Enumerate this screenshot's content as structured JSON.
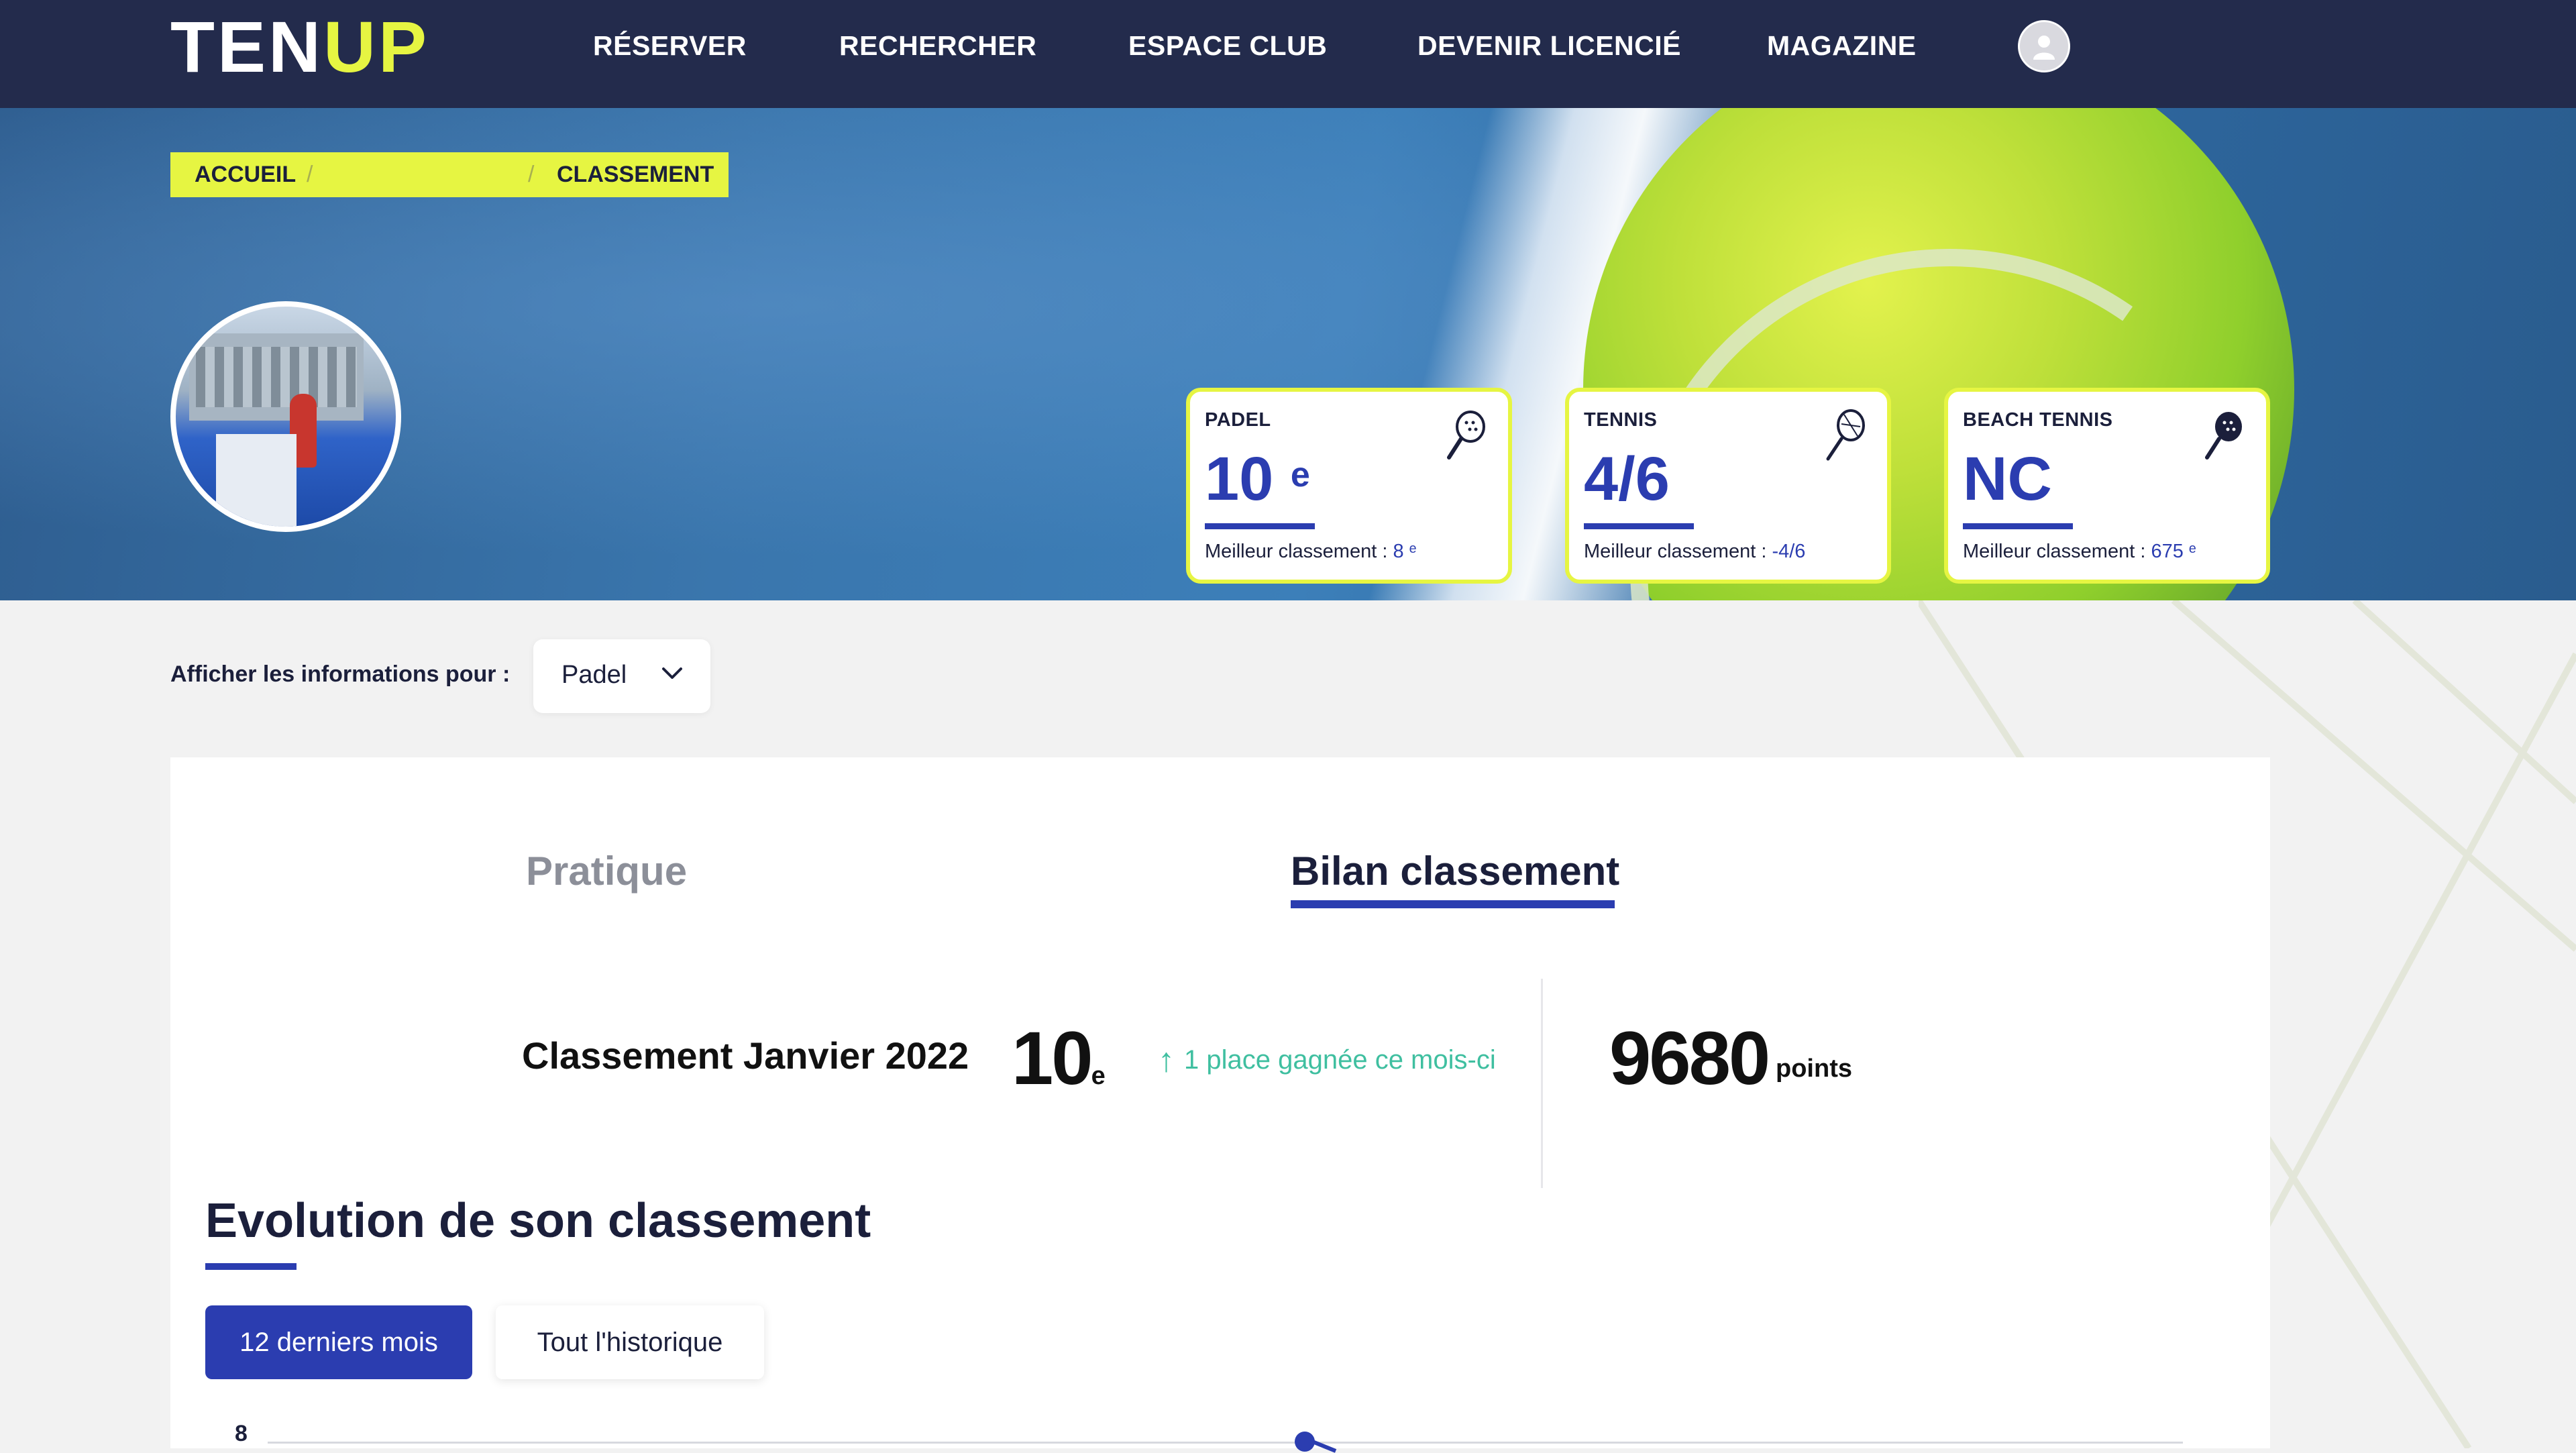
{
  "header": {
    "logo": {
      "part1": "TEN",
      "part2": "UP"
    },
    "nav": [
      "RÉSERVER",
      "RECHERCHER",
      "ESPACE CLUB",
      "DEVENIR LICENCIÉ",
      "MAGAZINE"
    ]
  },
  "breadcrumb": {
    "home": "ACCUEIL",
    "current": "CLASSEMENT"
  },
  "cards": [
    {
      "sport": "PADEL",
      "value": "10",
      "suffix": "e",
      "best_label": "Meilleur classement : ",
      "best_value": "8 ᵉ"
    },
    {
      "sport": "TENNIS",
      "value": "4/6",
      "suffix": "",
      "best_label": "Meilleur classement : ",
      "best_value": "-4/6"
    },
    {
      "sport": "BEACH TENNIS",
      "value": "NC",
      "suffix": "",
      "best_label": "Meilleur classement : ",
      "best_value": "675 ᵉ"
    }
  ],
  "selector": {
    "label": "Afficher les informations pour :",
    "value": "Padel"
  },
  "tabs": {
    "inactive": "Pratique",
    "active": "Bilan classement"
  },
  "ranking": {
    "label": "Classement Janvier 2022",
    "value": "10",
    "suffix": "e",
    "gain_arrow": "↑",
    "gain_text": "1 place gagnée ce mois-ci",
    "points": "9680",
    "points_unit": "points"
  },
  "evolution": {
    "title": "Evolution de son classement",
    "btn_12m": "12 derniers mois",
    "btn_all": "Tout l'historique"
  },
  "chart_data": {
    "type": "line",
    "y_tick_labels": [
      "8"
    ]
  },
  "colors": {
    "navy": "#232b4c",
    "accent_yellow": "#e6f542",
    "primary_blue": "#2b3db0",
    "gain_green": "#3fbfa0"
  }
}
